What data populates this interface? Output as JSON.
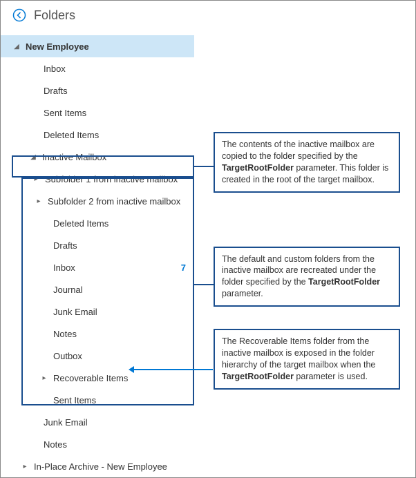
{
  "header": {
    "title": "Folders"
  },
  "tree": {
    "root": "New Employee",
    "items": [
      "Inbox",
      "Drafts",
      "Sent Items",
      "Deleted Items"
    ],
    "inactive": {
      "label": "Inactive Mailbox",
      "sub1": "Subfolder 1 from inactive mailbox",
      "sub2": "Subfolder 2 from inactive mailbox",
      "folders": [
        "Deleted Items",
        "Drafts",
        "Inbox",
        "Journal",
        "Junk Email",
        "Notes",
        "Outbox",
        "Recoverable Items",
        "Sent Items"
      ],
      "inbox_count": "7"
    },
    "after": [
      "Junk Email",
      "Notes"
    ],
    "archive": "In-Place Archive - New Employee"
  },
  "callouts": {
    "c1a": "The contents of the inactive mailbox are copied to the folder specified by the ",
    "c1b": "TargetRootFolder",
    "c1c": " parameter. This folder is created in the root of the target mailbox.",
    "c2a": "The default and custom folders from the inactive mailbox are recreated under the folder specified by the ",
    "c2b": "TargetRootFolder",
    "c2c": " parameter.",
    "c3a": "The Recoverable Items folder from the inactive mailbox is exposed in the folder hierarchy of the target mailbox when the ",
    "c3b": "TargetRootFolder",
    "c3c": " parameter is used."
  }
}
